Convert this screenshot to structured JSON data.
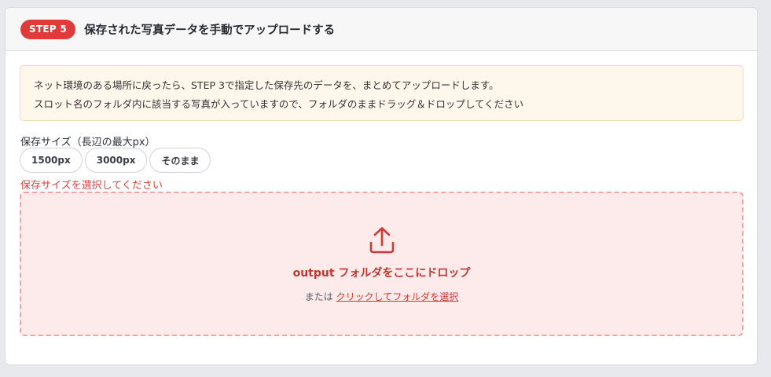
{
  "colors": {
    "accent": "#e03a3a",
    "error_text": "#d9443f",
    "dropzone_bg": "#fdeaea",
    "dropzone_border": "#f1a4a4",
    "notice_bg": "#fdf7ec"
  },
  "header": {
    "step_badge": "STEP 5",
    "title": "保存された写真データを手動でアップロードする"
  },
  "notice": {
    "line1": "ネット環境のある場所に戻ったら、STEP 3で指定した保存先のデータを、まとめてアップロードします。",
    "line2": "スロット名のフォルダ内に該当する写真が入っていますので、フォルダのままドラッグ＆ドロップしてください"
  },
  "size": {
    "label": "保存サイズ（長辺の最大px）",
    "options": [
      "1500px",
      "3000px",
      "そのまま"
    ],
    "error": "保存サイズを選択してください"
  },
  "dropzone": {
    "icon": "upload-icon",
    "title": "output フォルダをここにドロップ",
    "or_text": "または",
    "link_text": "クリックしてフォルダを選択"
  }
}
